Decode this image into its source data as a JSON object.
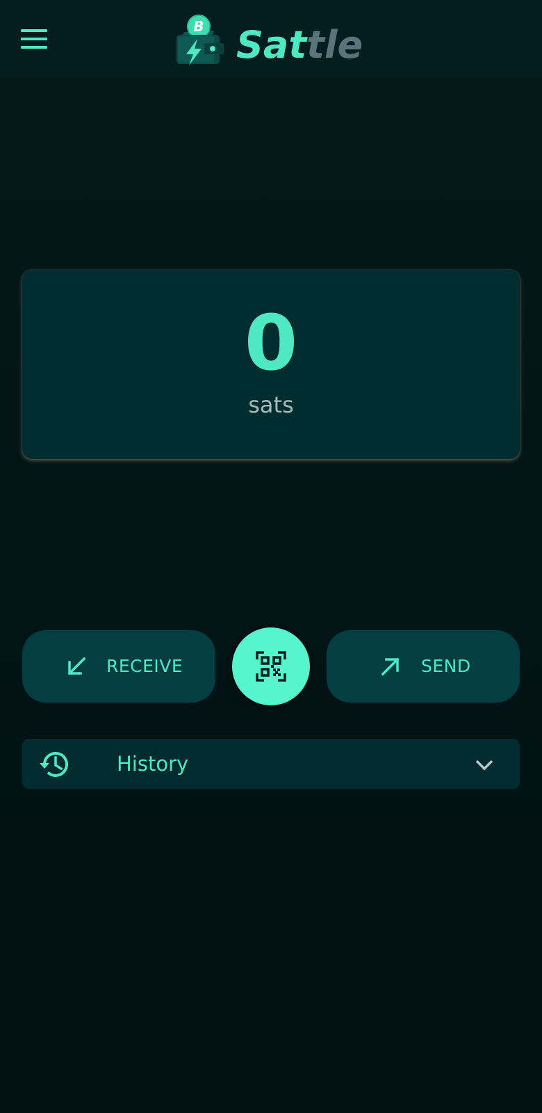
{
  "header": {
    "logo_text_a": "Sat",
    "logo_text_b": "tle",
    "icons": {
      "menu": "hamburger-menu-icon",
      "logo": "bitcoin-wallet-lightning-icon"
    }
  },
  "balance": {
    "amount": "0",
    "unit": "sats"
  },
  "actions": {
    "receive_label": "RECEIVE",
    "send_label": "SEND",
    "icons": {
      "receive": "arrow-down-left-icon",
      "scan": "qr-scan-icon",
      "send": "arrow-up-right-icon"
    }
  },
  "history": {
    "label": "History",
    "icons": {
      "history": "history-clock-icon",
      "expand": "chevron-down-icon"
    }
  },
  "colors": {
    "accent": "#4ee8c2",
    "accent_bright": "#57f5cd",
    "background": "#031416",
    "card": "#022d30",
    "button": "#033f42",
    "muted_text": "#a9b8b8",
    "logo_gray": "#59757a"
  }
}
